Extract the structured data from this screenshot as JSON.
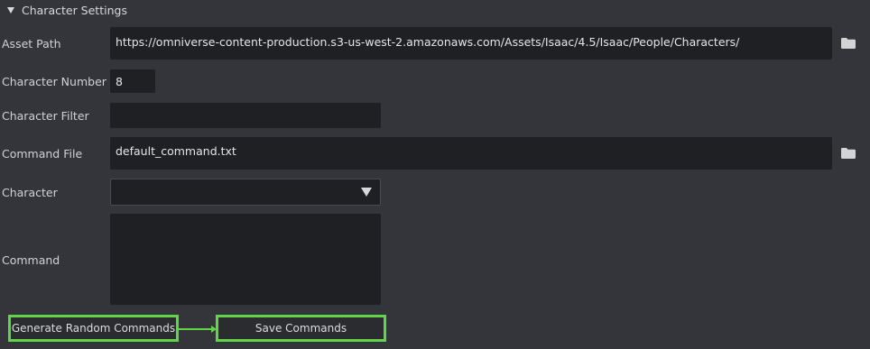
{
  "section": {
    "title": "Character Settings"
  },
  "fields": {
    "asset_path": {
      "label": "Asset Path",
      "value": "https://omniverse-content-production.s3-us-west-2.amazonaws.com/Assets/Isaac/4.5/Isaac/People/Characters/"
    },
    "character_number": {
      "label": "Character Number",
      "value": "8"
    },
    "character_filter": {
      "label": "Character Filter",
      "value": ""
    },
    "command_file": {
      "label": "Command File",
      "value": "default_command.txt"
    },
    "character": {
      "label": "Character",
      "value": ""
    },
    "command": {
      "label": "Command",
      "value": ""
    }
  },
  "buttons": {
    "generate": "Generate Random Commands",
    "save": "Save Commands"
  },
  "icons": {
    "folder": "folder-icon",
    "dropdown": "chevron-down-icon",
    "collapse": "triangle-down-icon"
  },
  "colors": {
    "background": "#34353a",
    "field": "#1f2023",
    "highlight": "#5fd547"
  }
}
